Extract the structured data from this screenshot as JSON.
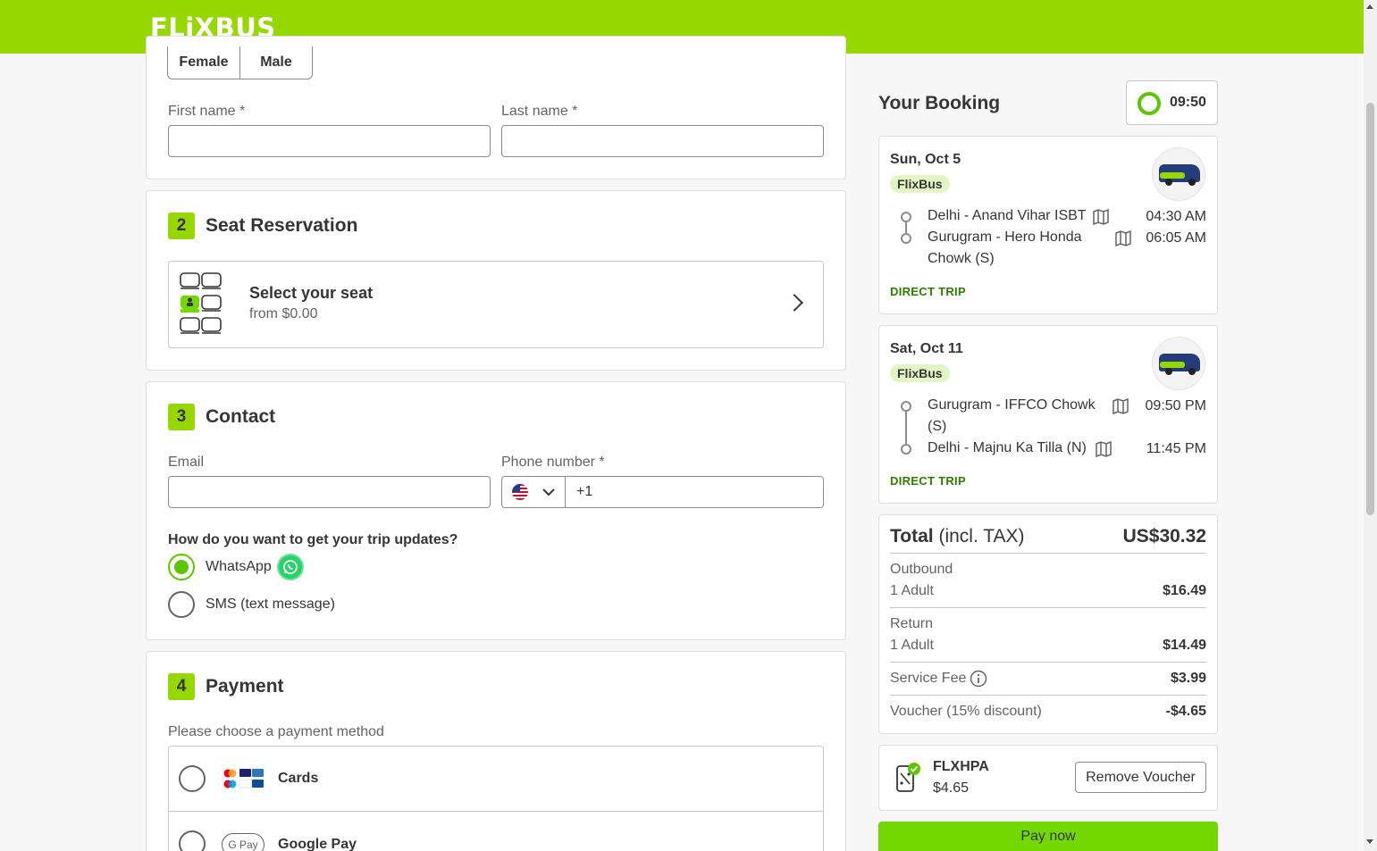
{
  "header": {
    "logo": "FLiXBUS"
  },
  "gender": {
    "female": "Female",
    "male": "Male"
  },
  "name_fields": {
    "first_label": "First name *",
    "last_label": "Last name *"
  },
  "seat": {
    "number": "2",
    "title": "Seat Reservation",
    "option_title": "Select your seat",
    "option_sub": "from $0.00"
  },
  "contact": {
    "number": "3",
    "title": "Contact",
    "email_label": "Email",
    "phone_label": "Phone number *",
    "phone_prefix": "+1",
    "updates_question": "How do you want to get your trip updates?",
    "options": [
      "WhatsApp",
      "SMS (text message)"
    ],
    "selected": "WhatsApp"
  },
  "payment": {
    "number": "4",
    "title": "Payment",
    "instruction": "Please choose a payment method",
    "methods": [
      "Cards",
      "Google Pay"
    ]
  },
  "booking": {
    "title": "Your Booking",
    "timer": "09:50",
    "trips": [
      {
        "date": "Sun, Oct 5",
        "brand": "FlixBus",
        "from": "Delhi - Anand Vihar ISBT",
        "from_time": "04:30 AM",
        "to_line1": "Gurugram - Hero Honda",
        "to_line2": "Chowk (S)",
        "to_time": "06:05 AM",
        "type": "DIRECT TRIP"
      },
      {
        "date": "Sat, Oct 11",
        "brand": "FlixBus",
        "from_line1": "Gurugram - IFFCO Chowk",
        "from_line2": "(S)",
        "from_time": "09:50 PM",
        "to": "Delhi - Majnu Ka Tilla (N)",
        "to_time": "11:45 PM",
        "type": "DIRECT TRIP"
      }
    ],
    "total": {
      "label_bold": "Total",
      "label_rest": "(incl. TAX)",
      "value": "US$30.32"
    },
    "outbound": {
      "label": "Outbound",
      "sub": "1 Adult",
      "value": "$16.49"
    },
    "return": {
      "label": "Return",
      "sub": "1 Adult",
      "value": "$14.49"
    },
    "service_fee": {
      "label": "Service Fee",
      "value": "$3.99"
    },
    "voucher_discount": {
      "label": "Voucher (15% discount)",
      "value": "-$4.65"
    },
    "voucher": {
      "code": "FLXHPA",
      "amount": "$4.65",
      "remove_label": "Remove Voucher"
    },
    "pay_label": "Pay now"
  },
  "colors": {
    "brand": "#97d700",
    "button": "#73d700",
    "radio": "#5cc500",
    "direct": "#2f7d00"
  }
}
